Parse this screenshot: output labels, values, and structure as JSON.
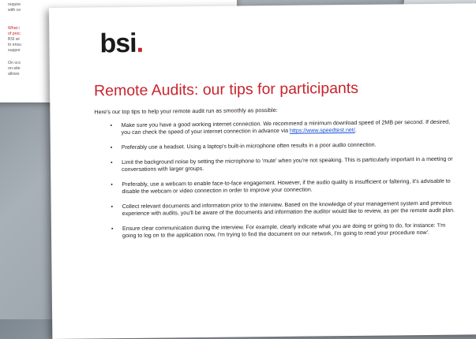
{
  "background_page": {
    "lines": [
      "require",
      "with ce"
    ],
    "red_lines": [
      "What i",
      "of proc"
    ],
    "lines2": [
      "BSI wi",
      "to ensu",
      "suppor"
    ],
    "lines3": [
      "On occ",
      "on-site",
      "allows"
    ]
  },
  "doc": {
    "logo_text": "bsi",
    "logo_dot": ".",
    "title": "Remote Audits: our tips for participants",
    "intro": "Here's our top tips to help your remote audit run as smoothly as possible:",
    "bullet": "•",
    "tips": [
      {
        "pre": "Make sure you have a good working internet connection. We recommend a minimum download speed of 2MB per second. If desired, you can check the speed of your internet connection in advance via ",
        "link": "https://www.speedtest.net/",
        "post": "."
      },
      {
        "text": "Preferably use a headset. Using a laptop's built-in microphone often results in a poor audio connection."
      },
      {
        "text": "Limit the background noise by setting the microphone to 'mute' when you're not speaking. This is particularly important in a meeting or conversations with larger groups."
      },
      {
        "text": "Preferably, use a webcam to enable face-to-face engagement. However, if the audio quality is insufficient or faltering, it's advisable to disable the webcam or video connection in order to improve your connection."
      },
      {
        "text": "Collect relevant documents and information prior to the interview. Based on the knowledge of your management system and previous experience with audits, you'll be aware of the documents and information the auditor would like to review, as per the remote audit plan."
      },
      {
        "text": "Ensure clear communication during the interview. For example, clearly indicate what you are doing or going to do, for instance: 'I'm going to log on to the application now, I'm trying to find the document on our network, I'm going to read your procedure now'."
      }
    ]
  }
}
